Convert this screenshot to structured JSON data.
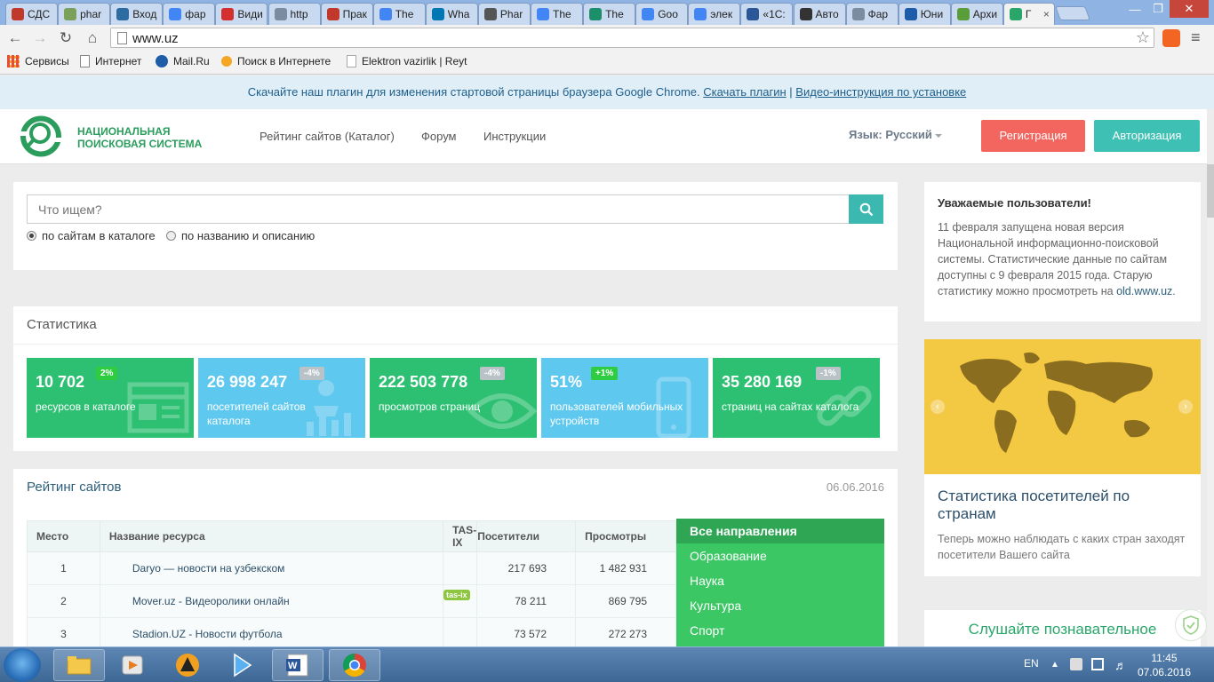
{
  "browser": {
    "tabs": [
      {
        "label": "СДС",
        "color": "#c0392b"
      },
      {
        "label": "phar",
        "color": "#7aa05a"
      },
      {
        "label": "Вход",
        "color": "#2d6ca2"
      },
      {
        "label": "фар",
        "color": "#4285f4"
      },
      {
        "label": "Види",
        "color": "#d32f2f"
      },
      {
        "label": "http",
        "color": "#7d8ba0"
      },
      {
        "label": "Прак",
        "color": "#c0392b"
      },
      {
        "label": "The",
        "color": "#4285f4"
      },
      {
        "label": "Wha",
        "color": "#0077b5"
      },
      {
        "label": "Phar",
        "color": "#555555"
      },
      {
        "label": "The",
        "color": "#4285f4"
      },
      {
        "label": "The",
        "color": "#1a8f6a"
      },
      {
        "label": "Goo",
        "color": "#4285f4"
      },
      {
        "label": "элек",
        "color": "#4285f4"
      },
      {
        "label": "«1С:",
        "color": "#2b5797"
      },
      {
        "label": "Авто",
        "color": "#333333"
      },
      {
        "label": "Фар",
        "color": "#7d8ba0"
      },
      {
        "label": "Юни",
        "color": "#1e5ba8"
      },
      {
        "label": "Архи",
        "color": "#5a9e3c"
      },
      {
        "label": "Г",
        "color": "#2aa66a",
        "active": true
      }
    ],
    "close_glyph": "×",
    "url": "www.uz",
    "bookmarks": [
      {
        "label": "Сервисы",
        "color": "#e74c3c"
      },
      {
        "label": "Интернет",
        "color": "#888888"
      },
      {
        "label": "Mail.Ru",
        "color": "#1e5ba8"
      },
      {
        "label": "Поиск в Интернете",
        "color": "#f5a623"
      },
      {
        "label": "Elektron vazirlik | Reyt",
        "color": "#aaaaaa"
      }
    ]
  },
  "site": {
    "plugin_bar": {
      "text": "Скачайте наш плагин для изменения стартовой страницы браузера Google Chrome.",
      "link1": "Скачать плагин",
      "separator": "|",
      "link2": "Видео-инструкция по установке"
    },
    "logo_line1": "НАЦИОНАЛЬНАЯ",
    "logo_line2": "ПОИСКОВАЯ СИСТЕМА",
    "nav": [
      "Рейтинг сайтов (Каталог)",
      "Форум",
      "Инструкции"
    ],
    "language": "Язык: Русский",
    "register_label": "Регистрация",
    "login_label": "Авторизация",
    "colors": {
      "register": "#f2665f",
      "login": "#3ec1b4",
      "brand": "#2a9d5c"
    }
  },
  "search": {
    "placeholder": "Что ищем?",
    "option_catalog": "по сайтам в каталоге",
    "option_name": "по названию и описанию",
    "selected": "по сайтам в каталоге"
  },
  "stats": {
    "title": "Статистика",
    "cards": [
      {
        "value": "10 702",
        "badge": "2%",
        "label": "ресурсов в каталоге",
        "color": "#2dbf72",
        "badge_color": "#2ecc40"
      },
      {
        "value": "26 998 247",
        "badge": "-4%",
        "label": "посетителей сайтов каталога",
        "color": "#5fc8ee",
        "badge_color": "#b9c3c7"
      },
      {
        "value": "222 503 778",
        "badge": "-4%",
        "label": "просмотров страниц",
        "color": "#2dbf72",
        "badge_color": "#b9c3c7"
      },
      {
        "value": "51%",
        "badge": "+1%",
        "label": "пользователей мобильных устройств",
        "color": "#5fc8ee",
        "badge_color": "#2ecc40"
      },
      {
        "value": "35 280 169",
        "badge": "-1%",
        "label": "страниц на сайтах каталога",
        "color": "#2dbf72",
        "badge_color": "#b9c3c7"
      }
    ]
  },
  "rating": {
    "title": "Рейтинг сайтов",
    "date": "06.06.2016",
    "columns": [
      "Место",
      "Название ресурса",
      "TAS-IX",
      "Посетители",
      "Просмотры"
    ],
    "rows": [
      {
        "place": "1",
        "name": "Daryo — новости на узбекском",
        "tasix": "",
        "visitors": "217 693",
        "views": "1 482 931"
      },
      {
        "place": "2",
        "name": "Mover.uz - Видеоролики онлайн",
        "tasix": "tas-ix",
        "visitors": "78 211",
        "views": "869 795"
      },
      {
        "place": "3",
        "name": "Stadion.UZ - Новости футбола",
        "tasix": "",
        "visitors": "73 572",
        "views": "272 273"
      }
    ],
    "directions": [
      "Все направления",
      "Образование",
      "Наука",
      "Культура",
      "Спорт"
    ]
  },
  "sidebar": {
    "notice_title": "Уважаемые пользователи!",
    "notice_text": "11 февраля запущена новая версия Национальной информационно-поисковой системы. Статистические данные по сайтам доступны с 9 февраля 2015 года. Старую статистику можно просмотреть на",
    "notice_link": "old.www.uz",
    "notice_end": ".",
    "map_title": "Статистика посетителей по странам",
    "map_text": "Теперь можно наблюдать с каких стран заходят посетители Вашего сайта",
    "listen_title": "Слушайте познавательное"
  },
  "taskbar": {
    "language": "EN",
    "time": "11:45",
    "date": "07.06.2016"
  }
}
